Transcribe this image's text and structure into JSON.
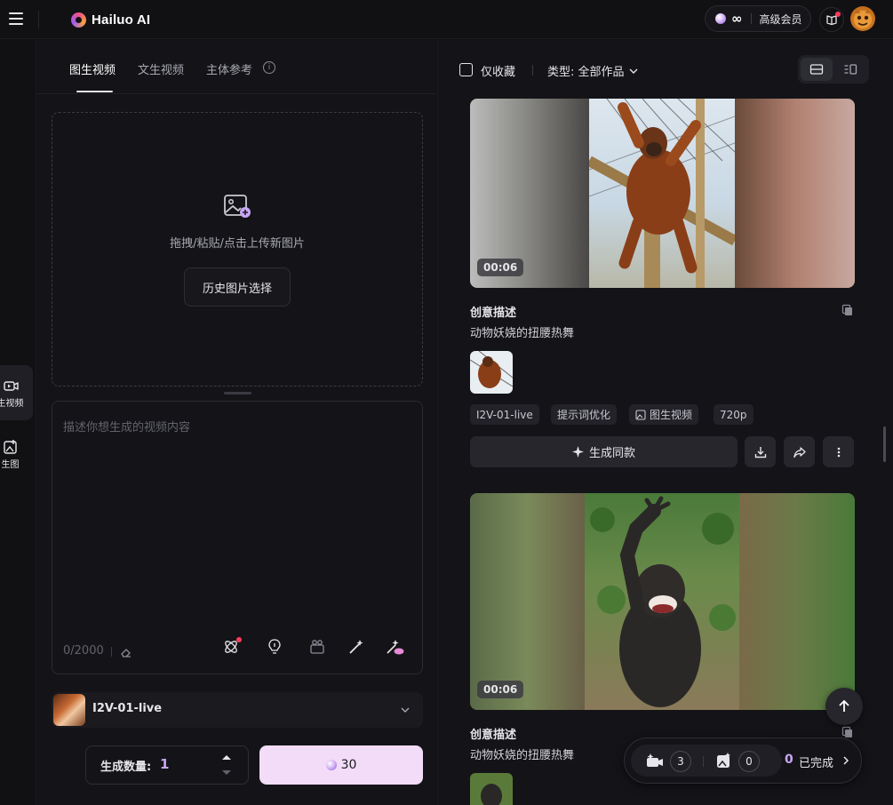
{
  "app": {
    "logo_text": "Hailuo AI"
  },
  "header": {
    "vip_symbol": "∞",
    "vip_label": "高级会员"
  },
  "rail": {
    "items": [
      {
        "label": "生视频"
      },
      {
        "label": "生图"
      }
    ]
  },
  "left_panel": {
    "tabs": [
      {
        "label": "图生视频"
      },
      {
        "label": "文生视频"
      },
      {
        "label": "主体参考"
      }
    ],
    "upload": {
      "hint": "拖拽/粘贴/点击上传新图片",
      "history_button": "历史图片选择"
    },
    "prompt": {
      "placeholder": "描述你想生成的视频内容",
      "counter": "0/2000"
    },
    "model": {
      "name": "I2V-01-live"
    },
    "quantity": {
      "label": "生成数量:",
      "value": "1"
    },
    "generate": {
      "cost": "30"
    }
  },
  "right_panel": {
    "filter": {
      "favorites_label": "仅收藏",
      "type_label": "类型:",
      "type_value": "全部作品"
    },
    "cards": [
      {
        "duration": "00:06",
        "title": "创意描述",
        "description": "动物妖娆的扭腰热舞",
        "tags": [
          "I2V-01-live",
          "提示词优化",
          "图生视频",
          "720p"
        ],
        "same_button": "生成同款"
      },
      {
        "duration": "00:06",
        "title": "创意描述",
        "description": "动物妖娆的扭腰热舞"
      }
    ]
  },
  "queue": {
    "video_count": "3",
    "image_count": "0",
    "done_count": "0",
    "done_label": "已完成"
  },
  "colors": {
    "accent": "#c9a6f5",
    "generate_bg": "#f2dcf7",
    "background": "#111114",
    "panel": "#141418"
  }
}
